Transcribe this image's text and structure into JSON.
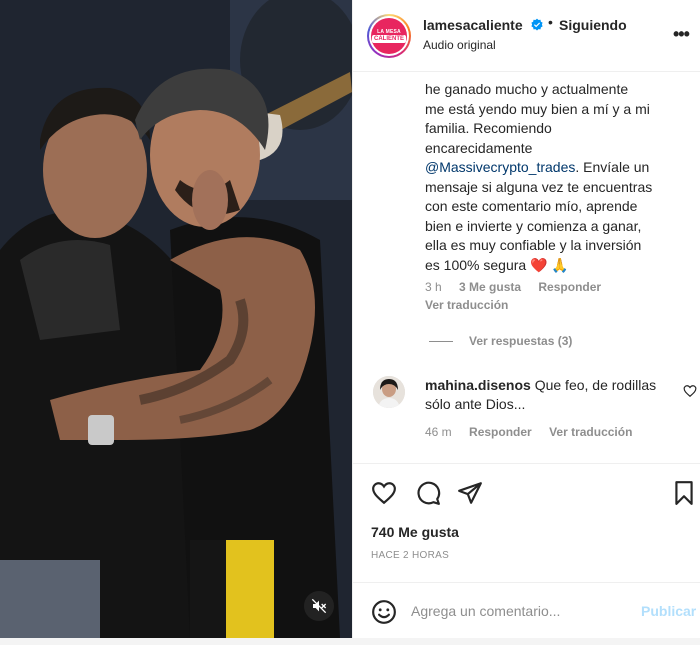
{
  "header": {
    "username": "lamesacaliente",
    "avatar_logo_top": "LA MESA",
    "avatar_logo_main": "CALIENTE",
    "separator": "•",
    "following_label": "Siguiendo",
    "audio_label": "Audio original",
    "more_icon": "more-horizontal-icon"
  },
  "comment1": {
    "line1": "he ganado mucho y actualmente",
    "line2": "me está yendo muy bien a mí y a mi",
    "line3": "familia. Recomiendo",
    "line4": "encarecidamente",
    "mention": "@Massivecrypto_trades",
    "line5_rest": ". Envíale un",
    "line6": "mensaje si alguna vez te encuentras",
    "line7": "con este comentario mío, aprende",
    "line8": "bien e invierte y comienza a ganar,",
    "line9": "ella es muy confiable y la inversión",
    "line10": "es 100% segura ❤️ 🙏",
    "time": "3 h",
    "likes": "3 Me gusta",
    "reply": "Responder",
    "translate": "Ver traducción",
    "view_replies": "Ver respuestas (3)"
  },
  "comment2": {
    "username": "mahina.disenos",
    "text": "Que feo, de rodillas sólo ante Dios...",
    "time": "46 m",
    "reply": "Responder",
    "translate": "Ver traducción"
  },
  "actions": {
    "likes_count": "740 Me gusta",
    "time_ago": "HACE 2 HORAS"
  },
  "add_comment": {
    "placeholder": "Agrega un comentario...",
    "post_label": "Publicar"
  },
  "colors": {
    "link": "#00376b",
    "meta": "#8e8e8e",
    "post_button_disabled": "#b2dffc",
    "verified": "#0095f6"
  }
}
